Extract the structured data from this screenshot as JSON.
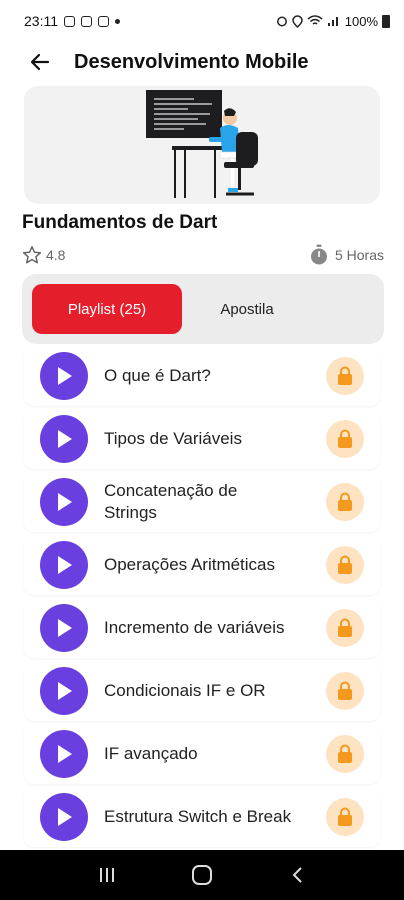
{
  "status_bar": {
    "time": "23:11",
    "battery": "100%"
  },
  "header": {
    "title": "Desenvolvimento Mobile"
  },
  "course": {
    "title": "Fundamentos de Dart",
    "rating": "4.8",
    "duration": "5 Horas"
  },
  "tabs": [
    {
      "label": "Playlist (25)",
      "active": true
    },
    {
      "label": "Apostila",
      "active": false
    }
  ],
  "playlist": [
    {
      "label": "O que é Dart?"
    },
    {
      "label": "Tipos de Variáveis"
    },
    {
      "label": "Concatenação de Strings"
    },
    {
      "label": "Operações Aritméticas"
    },
    {
      "label": "Incremento de variáveis"
    },
    {
      "label": "Condicionais IF e OR"
    },
    {
      "label": "IF avançado"
    },
    {
      "label": "Estrutura Switch e Break"
    }
  ],
  "colors": {
    "accent": "#e41e2b",
    "play": "#6a3fe0",
    "lock_bg": "#fde3c2",
    "lock": "#f39a1e"
  },
  "icons": {
    "back": "arrow-left-icon",
    "rating": "star-outline-icon",
    "duration": "stopwatch-icon",
    "play": "play-icon",
    "lock": "lock-icon"
  }
}
